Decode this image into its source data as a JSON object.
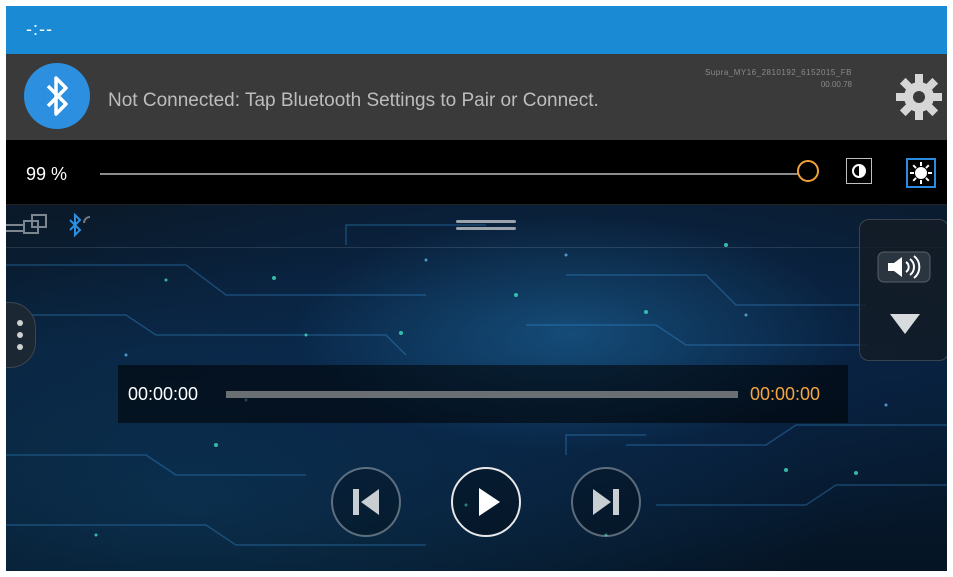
{
  "status_bar": {
    "clock": "-:--",
    "color": "#1a8ad4"
  },
  "notification": {
    "icon": "bluetooth-icon",
    "message": "Not Connected: Tap Bluetooth Settings to Pair or Connect.",
    "version_line1": "Supra_MY16_2810192_6152015_FB",
    "version_line2": "00.00.78",
    "settings_icon": "gear-icon"
  },
  "brightness": {
    "percent_label": "99 %",
    "level": 0.99,
    "accent": "#f2a13a",
    "contrast_icon": "contrast-icon",
    "sun_icon": "sun-icon"
  },
  "player": {
    "elapsed": "00:00:00",
    "total": "00:00:00",
    "progress": 0,
    "total_color": "#f4a640",
    "controls": [
      "previous-icon",
      "play-icon",
      "next-icon"
    ],
    "volume_icon": "volume-icon",
    "collapse_icon": "triangle-down-icon"
  }
}
